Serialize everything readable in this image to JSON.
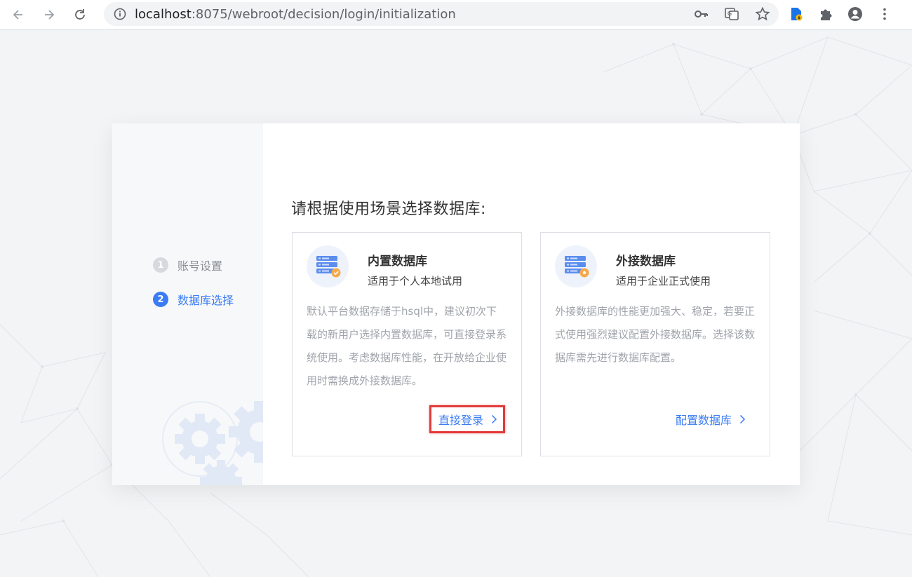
{
  "browser": {
    "url_host": "localhost",
    "url_rest": ":8075/webroot/decision/login/initialization",
    "icons": [
      "back-icon",
      "forward-icon",
      "reload-icon",
      "info-icon",
      "key-icon",
      "translate-icon",
      "star-icon",
      "extension-file-icon",
      "puzzle-icon",
      "profile-icon",
      "menu-icon"
    ]
  },
  "sidebar": {
    "steps": [
      {
        "num": "1",
        "label": "账号设置"
      },
      {
        "num": "2",
        "label": "数据库选择"
      }
    ]
  },
  "main": {
    "title": "请根据使用场景选择数据库:",
    "cards": [
      {
        "title": "内置数据库",
        "subtitle": "适用于个人本地试用",
        "desc": "默认平台数据存储于hsql中，建议初次下载的新用户选择内置数据库，可直接登录系统使用。考虑数据库性能，在开放给企业使用时需换成外接数据库。",
        "action": "直接登录"
      },
      {
        "title": "外接数据库",
        "subtitle": "适用于企业正式使用",
        "desc": "外接数据库的性能更加强大、稳定，若要正式使用强烈建议配置外接数据库。选择该数据库需先进行数据库配置。",
        "action": "配置数据库"
      }
    ]
  },
  "colors": {
    "accent": "#3a7cf3",
    "highlight": "#e23a3a",
    "muted": "#a0a4ab"
  }
}
